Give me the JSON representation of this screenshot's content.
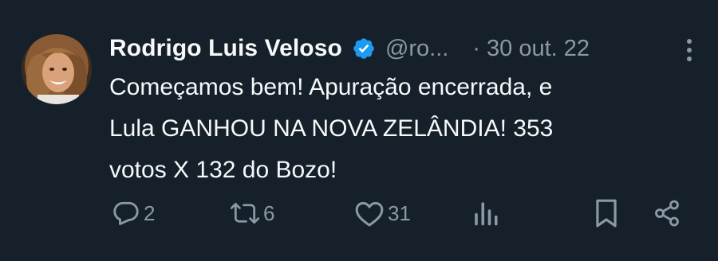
{
  "tweet": {
    "author_name": "Rodrigo Luis Veloso",
    "handle": "@ro...",
    "separator": "·",
    "timestamp": "30 out. 22",
    "text": "Começamos bem! Apuração encerrada, e\nLula GANHOU NA NOVA ZELÂNDIA! 353\nvotos X 132 do Bozo!",
    "verified": true
  },
  "actions": {
    "replies": "2",
    "retweets": "6",
    "likes": "31"
  },
  "icons": {
    "verified": "verified-badge-icon",
    "more": "more-options-icon",
    "reply": "reply-icon",
    "retweet": "retweet-icon",
    "like": "heart-icon",
    "views": "analytics-icon",
    "bookmark": "bookmark-icon",
    "share": "share-icon"
  },
  "colors": {
    "background": "#15202b",
    "text": "#f7f9f9",
    "secondary": "#8b98a5",
    "verified": "#1d9bf0"
  }
}
